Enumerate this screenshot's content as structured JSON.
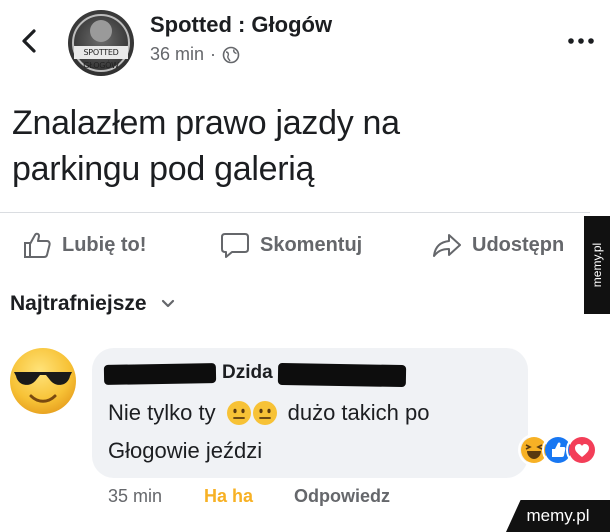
{
  "post": {
    "page_name": "Spotted : Głogów",
    "avatar_text": "SPOTTED GŁOGÓW",
    "time": "36 min",
    "separator": "·",
    "text_line1": "Znalazłem prawo jazdy na",
    "text_line2": "parkingu pod galerią"
  },
  "actions": {
    "like": "Lubię to!",
    "comment": "Skomentuj",
    "share": "Udostępn"
  },
  "comments": {
    "sort_label": "Najtrafniejsze",
    "items": [
      {
        "name": "Dzida",
        "text_part1": "Nie tylko ty",
        "text_part2": "dużo takich po",
        "text_line2": "Głogowie jeździ",
        "time": "35 min",
        "reaction_label": "Ha ha",
        "reply_label": "Odpowiedz",
        "reactions": [
          "haha",
          "like",
          "love"
        ]
      }
    ]
  },
  "watermarks": {
    "side": "memy.pl",
    "bottom": "memy.pl"
  },
  "colors": {
    "secondary_text": "#65676b",
    "bubble_bg": "#f0f2f5",
    "haha_yellow": "#f7b125",
    "like_blue": "#1877f2",
    "love_red": "#f33e58"
  }
}
